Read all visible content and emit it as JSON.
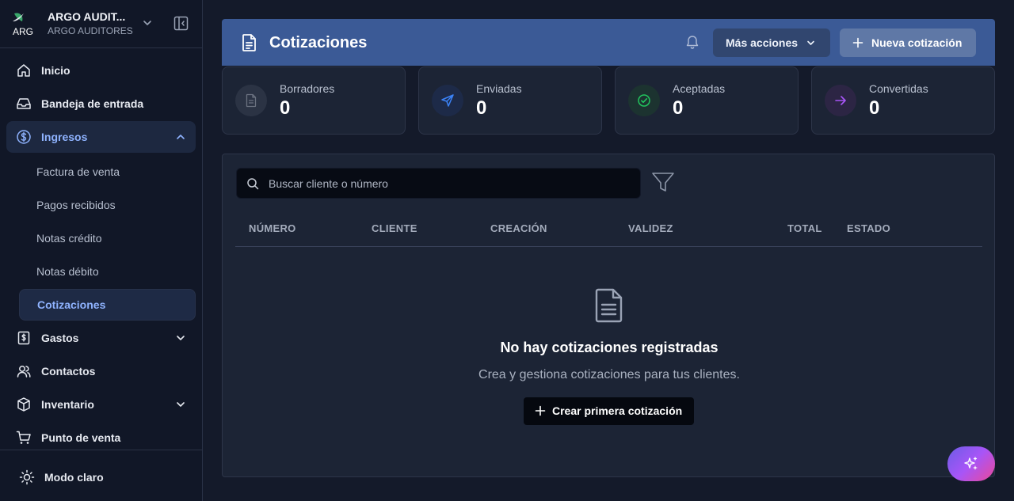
{
  "org": {
    "name": "ARGO AUDIT...",
    "subtitle": "ARGO AUDITORES",
    "logo_text": "ARG"
  },
  "nav": {
    "home": "Inicio",
    "inbox": "Bandeja de entrada",
    "income": "Ingresos",
    "income_sub": [
      "Factura de venta",
      "Pagos recibidos",
      "Notas crédito",
      "Notas débito",
      "Cotizaciones"
    ],
    "expenses": "Gastos",
    "contacts": "Contactos",
    "inventory": "Inventario",
    "pos": "Punto de venta"
  },
  "theme_toggle": "Modo claro",
  "header": {
    "title": "Cotizaciones",
    "more_actions": "Más acciones",
    "new_quote": "Nueva cotización"
  },
  "stats": [
    {
      "label": "Borradores",
      "value": "0"
    },
    {
      "label": "Enviadas",
      "value": "0"
    },
    {
      "label": "Aceptadas",
      "value": "0"
    },
    {
      "label": "Convertidas",
      "value": "0"
    }
  ],
  "search": {
    "placeholder": "Buscar cliente o número"
  },
  "table": {
    "columns": [
      "NÚMERO",
      "CLIENTE",
      "CREACIÓN",
      "VALIDEZ",
      "TOTAL",
      "ESTADO"
    ]
  },
  "empty": {
    "title": "No hay cotizaciones registradas",
    "subtitle": "Crea y gestiona cotizaciones para tus clientes.",
    "button": "Crear primera cotización"
  },
  "colors": {
    "header_bg": "#3b5a96",
    "accent": "#8fb3ff",
    "borradores": "#6b7280",
    "enviadas": "#3b82f6",
    "aceptadas": "#22c55e",
    "convertidas": "#a855f7"
  }
}
